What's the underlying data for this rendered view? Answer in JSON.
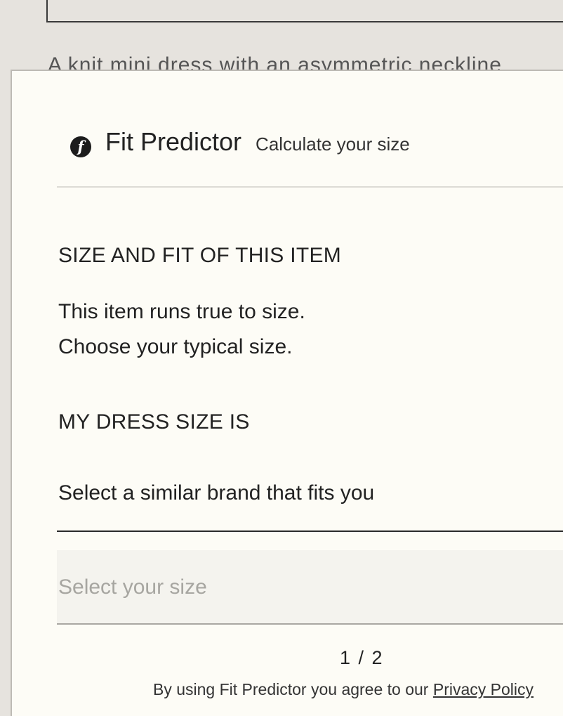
{
  "background": {
    "description_snippet": "A knit mini dress with an asymmetric neckline"
  },
  "modal": {
    "brand": "Fit Predictor",
    "tagline": "Calculate your size",
    "logo_glyph": "f",
    "fit_section": {
      "heading": "SIZE AND FIT OF THIS ITEM",
      "line1": "This item runs true to size.",
      "line2": "Choose your typical size."
    },
    "size_section": {
      "heading": "MY DRESS SIZE IS",
      "brand_select_placeholder": "Select a similar brand that fits you",
      "size_select_placeholder": "Select your size"
    },
    "pager": "1 / 2",
    "footer": {
      "text": "By using Fit Predictor you agree to our ",
      "link_label": "Privacy Policy"
    }
  },
  "colors": {
    "page_background": "#e6e3de",
    "modal_background": "#fdfcf6",
    "text": "#222222",
    "placeholder": "#a7a6a1"
  }
}
